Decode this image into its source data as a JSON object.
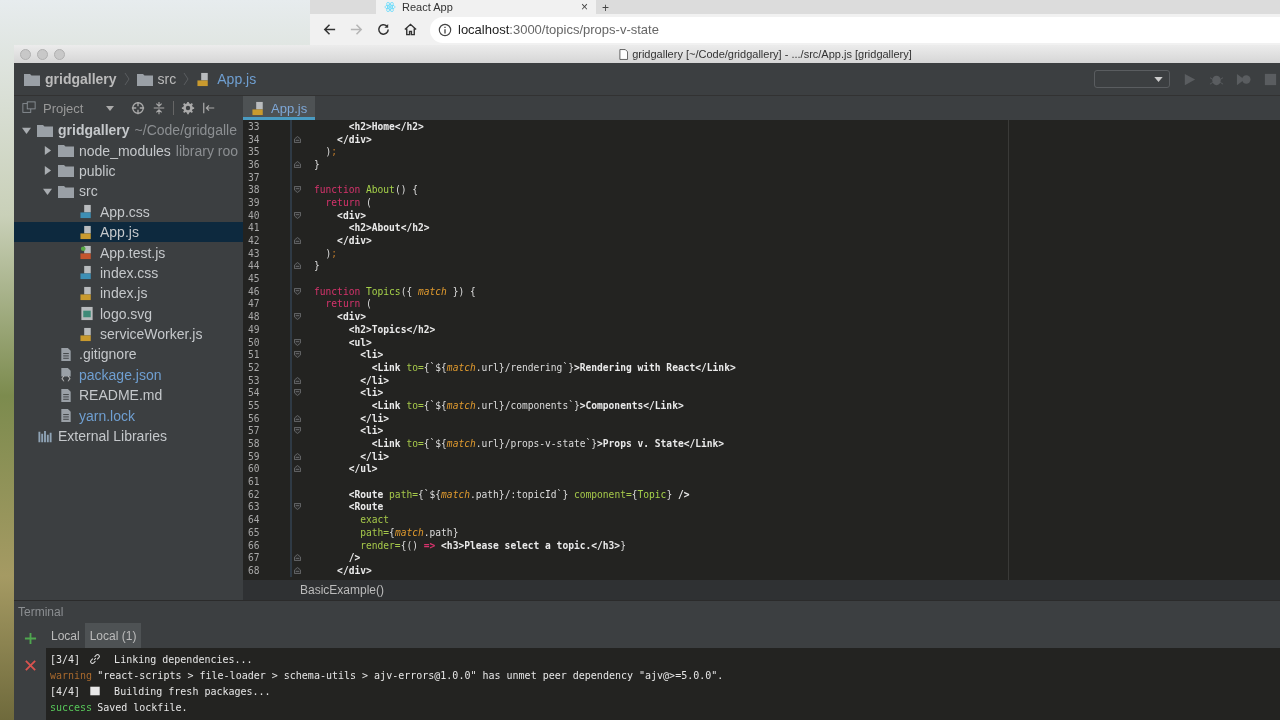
{
  "browser": {
    "tab": {
      "title": "React App",
      "close": "×"
    },
    "new_tab": "+",
    "forward_disabled": true,
    "url": {
      "host": "localhost",
      "rest": ":3000/topics/props-v-state"
    }
  },
  "ide": {
    "title": "gridgallery [~/Code/gridgallery] - .../src/App.js [gridgallery]",
    "breadcrumbs": [
      {
        "label": "gridgallery",
        "kind": "folder"
      },
      {
        "label": "src",
        "kind": "folder"
      },
      {
        "label": "App.js",
        "kind": "js"
      }
    ],
    "project_panel": {
      "title": "Project"
    },
    "tree": [
      {
        "label": "gridgallery",
        "hint": "~/Code/gridgalle",
        "kind": "module",
        "expanded": true,
        "selected": false,
        "children": [
          {
            "label": "node_modules",
            "hint": "library roo",
            "kind": "folder",
            "expanded": false,
            "selected": false
          },
          {
            "label": "public",
            "kind": "folder",
            "expanded": false,
            "selected": false
          },
          {
            "label": "src",
            "kind": "folder",
            "expanded": true,
            "selected": false,
            "children": [
              {
                "label": "App.css",
                "kind": "css",
                "selected": false,
                "modified": false
              },
              {
                "label": "App.js",
                "kind": "js",
                "selected": true,
                "modified": false
              },
              {
                "label": "App.test.js",
                "kind": "test",
                "selected": false,
                "modified": false
              },
              {
                "label": "index.css",
                "kind": "css",
                "selected": false,
                "modified": false
              },
              {
                "label": "index.js",
                "kind": "js",
                "selected": false,
                "modified": false
              },
              {
                "label": "logo.svg",
                "kind": "image",
                "selected": false,
                "modified": false
              },
              {
                "label": "serviceWorker.js",
                "kind": "js",
                "selected": false,
                "modified": false
              }
            ]
          },
          {
            "label": ".gitignore",
            "kind": "text",
            "selected": false,
            "modified": false
          },
          {
            "label": "package.json",
            "kind": "json",
            "selected": false,
            "modified": true
          },
          {
            "label": "README.md",
            "kind": "text",
            "selected": false,
            "modified": false
          },
          {
            "label": "yarn.lock",
            "kind": "text",
            "selected": false,
            "modified": true
          }
        ]
      },
      {
        "label": "External Libraries",
        "kind": "libraries",
        "selected": false
      }
    ],
    "editor_tabs": [
      {
        "label": "App.js",
        "selected": true
      }
    ],
    "code": [
      {
        "n": "33",
        "tokens": [
          {
            "kind": "tag",
            "text": "      <h2>Home</h2>"
          }
        ]
      },
      {
        "n": "34",
        "fold_close": true,
        "tokens": [
          {
            "kind": "tag",
            "text": "    </div>"
          }
        ]
      },
      {
        "n": "35",
        "tokens": [
          {
            "kind": "plain",
            "text": "  )"
          },
          {
            "kind": "punct",
            "text": ";"
          }
        ]
      },
      {
        "n": "36",
        "fold_close": true,
        "tokens": [
          {
            "kind": "plain",
            "text": "}"
          }
        ]
      },
      {
        "n": "37"
      },
      {
        "n": "38",
        "fold_open": true,
        "tokens": [
          {
            "kind": "keyword",
            "text": "function "
          },
          {
            "kind": "function",
            "text": "About"
          },
          {
            "kind": "plain",
            "text": "() {"
          }
        ]
      },
      {
        "n": "39",
        "tokens": [
          {
            "kind": "keyword",
            "text": "  return"
          },
          {
            "kind": "plain",
            "text": " ("
          }
        ]
      },
      {
        "n": "40",
        "fold_open": true,
        "tokens": [
          {
            "kind": "tag",
            "text": "    <div>"
          }
        ]
      },
      {
        "n": "41",
        "tokens": [
          {
            "kind": "tag",
            "text": "      <h2>About</h2>"
          }
        ]
      },
      {
        "n": "42",
        "fold_close": true,
        "tokens": [
          {
            "kind": "tag",
            "text": "    </div>"
          }
        ]
      },
      {
        "n": "43",
        "tokens": [
          {
            "kind": "plain",
            "text": "  )"
          },
          {
            "kind": "punct",
            "text": ";"
          }
        ]
      },
      {
        "n": "44",
        "fold_close": true,
        "tokens": [
          {
            "kind": "plain",
            "text": "}"
          }
        ]
      },
      {
        "n": "45"
      },
      {
        "n": "46",
        "fold_open": true,
        "tokens": [
          {
            "kind": "keyword",
            "text": "function "
          },
          {
            "kind": "function",
            "text": "Topics"
          },
          {
            "kind": "plain",
            "text": "({ "
          },
          {
            "kind": "param",
            "text": "match"
          },
          {
            "kind": "plain",
            "text": " }) {"
          }
        ]
      },
      {
        "n": "47",
        "tokens": [
          {
            "kind": "keyword",
            "text": "  return"
          },
          {
            "kind": "plain",
            "text": " ("
          }
        ]
      },
      {
        "n": "48",
        "fold_open": true,
        "tokens": [
          {
            "kind": "tag",
            "text": "    <div>"
          }
        ]
      },
      {
        "n": "49",
        "tokens": [
          {
            "kind": "tag",
            "text": "      <h2>Topics</h2>"
          }
        ]
      },
      {
        "n": "50",
        "fold_open": true,
        "tokens": [
          {
            "kind": "tag",
            "text": "      <ul>"
          }
        ]
      },
      {
        "n": "51",
        "fold_open": true,
        "tokens": [
          {
            "kind": "tag",
            "text": "        <li>"
          }
        ]
      },
      {
        "n": "52",
        "tokens": [
          {
            "kind": "tag",
            "text": "          <Link "
          },
          {
            "kind": "attr",
            "text": "to="
          },
          {
            "kind": "plain",
            "text": "{`${"
          },
          {
            "kind": "param",
            "text": "match"
          },
          {
            "kind": "plain",
            "text": ".url}/rendering`}"
          },
          {
            "kind": "tag",
            "text": ">Rendering with React</Link>"
          }
        ]
      },
      {
        "n": "53",
        "fold_close": true,
        "tokens": [
          {
            "kind": "tag",
            "text": "        </li>"
          }
        ]
      },
      {
        "n": "54",
        "fold_open": true,
        "tokens": [
          {
            "kind": "tag",
            "text": "        <li>"
          }
        ]
      },
      {
        "n": "55",
        "tokens": [
          {
            "kind": "tag",
            "text": "          <Link "
          },
          {
            "kind": "attr",
            "text": "to="
          },
          {
            "kind": "plain",
            "text": "{`${"
          },
          {
            "kind": "param",
            "text": "match"
          },
          {
            "kind": "plain",
            "text": ".url}/components`}"
          },
          {
            "kind": "tag",
            "text": ">Components</Link>"
          }
        ]
      },
      {
        "n": "56",
        "fold_close": true,
        "tokens": [
          {
            "kind": "tag",
            "text": "        </li>"
          }
        ]
      },
      {
        "n": "57",
        "fold_open": true,
        "tokens": [
          {
            "kind": "tag",
            "text": "        <li>"
          }
        ]
      },
      {
        "n": "58",
        "tokens": [
          {
            "kind": "tag",
            "text": "          <Link "
          },
          {
            "kind": "attr",
            "text": "to="
          },
          {
            "kind": "plain",
            "text": "{`${"
          },
          {
            "kind": "param",
            "text": "match"
          },
          {
            "kind": "plain",
            "text": ".url}/props-v-state`}"
          },
          {
            "kind": "tag",
            "text": ">Props v. State</Link>"
          }
        ]
      },
      {
        "n": "59",
        "fold_close": true,
        "tokens": [
          {
            "kind": "tag",
            "text": "        </li>"
          }
        ]
      },
      {
        "n": "60",
        "fold_close": true,
        "tokens": [
          {
            "kind": "tag",
            "text": "      </ul>"
          }
        ]
      },
      {
        "n": "61"
      },
      {
        "n": "62",
        "tokens": [
          {
            "kind": "tag",
            "text": "      <Route "
          },
          {
            "kind": "attr",
            "text": "path="
          },
          {
            "kind": "plain",
            "text": "{`${"
          },
          {
            "kind": "param",
            "text": "match"
          },
          {
            "kind": "plain",
            "text": ".path}/:topicId`} "
          },
          {
            "kind": "attr",
            "text": "component="
          },
          {
            "kind": "plain",
            "text": "{"
          },
          {
            "kind": "function",
            "text": "Topic"
          },
          {
            "kind": "plain",
            "text": "} "
          },
          {
            "kind": "tag",
            "text": "/>"
          }
        ]
      },
      {
        "n": "63",
        "fold_open": true,
        "tokens": [
          {
            "kind": "tag",
            "text": "      <Route"
          }
        ]
      },
      {
        "n": "64",
        "tokens": [
          {
            "kind": "attr",
            "text": "        exact"
          }
        ]
      },
      {
        "n": "65",
        "tokens": [
          {
            "kind": "attr",
            "text": "        path="
          },
          {
            "kind": "plain",
            "text": "{"
          },
          {
            "kind": "param",
            "text": "match"
          },
          {
            "kind": "plain",
            "text": ".path}"
          }
        ]
      },
      {
        "n": "66",
        "tokens": [
          {
            "kind": "attr",
            "text": "        render="
          },
          {
            "kind": "plain",
            "text": "{() "
          },
          {
            "kind": "operator",
            "text": "=>"
          },
          {
            "kind": "tag",
            "text": " <h3>Please select a topic.</h3>"
          },
          {
            "kind": "plain",
            "text": "}"
          }
        ]
      },
      {
        "n": "67",
        "fold_close": true,
        "tokens": [
          {
            "kind": "tag",
            "text": "      />"
          }
        ]
      },
      {
        "n": "68",
        "fold_close": true,
        "tokens": [
          {
            "kind": "tag",
            "text": "    </div>"
          }
        ]
      }
    ],
    "code_breadcrumb": "BasicExample()",
    "terminal": {
      "title": "Terminal",
      "tabs": [
        {
          "label": "Local",
          "selected": false
        },
        {
          "label": "Local (1)",
          "selected": true
        }
      ],
      "lines": [
        {
          "status": "[3/4]",
          "kind": "step",
          "text": "Linking dependencies..."
        },
        {
          "status": "warning",
          "kind": "warning",
          "text": "\"react-scripts > file-loader > schema-utils > ajv-errors@1.0.0\" has unmet peer dependency \"ajv@>=5.0.0\"."
        },
        {
          "status": "[4/4]",
          "kind": "step",
          "text": "Building fresh packages..."
        },
        {
          "status": "success",
          "kind": "success",
          "text": "Saved lockfile."
        }
      ]
    }
  }
}
